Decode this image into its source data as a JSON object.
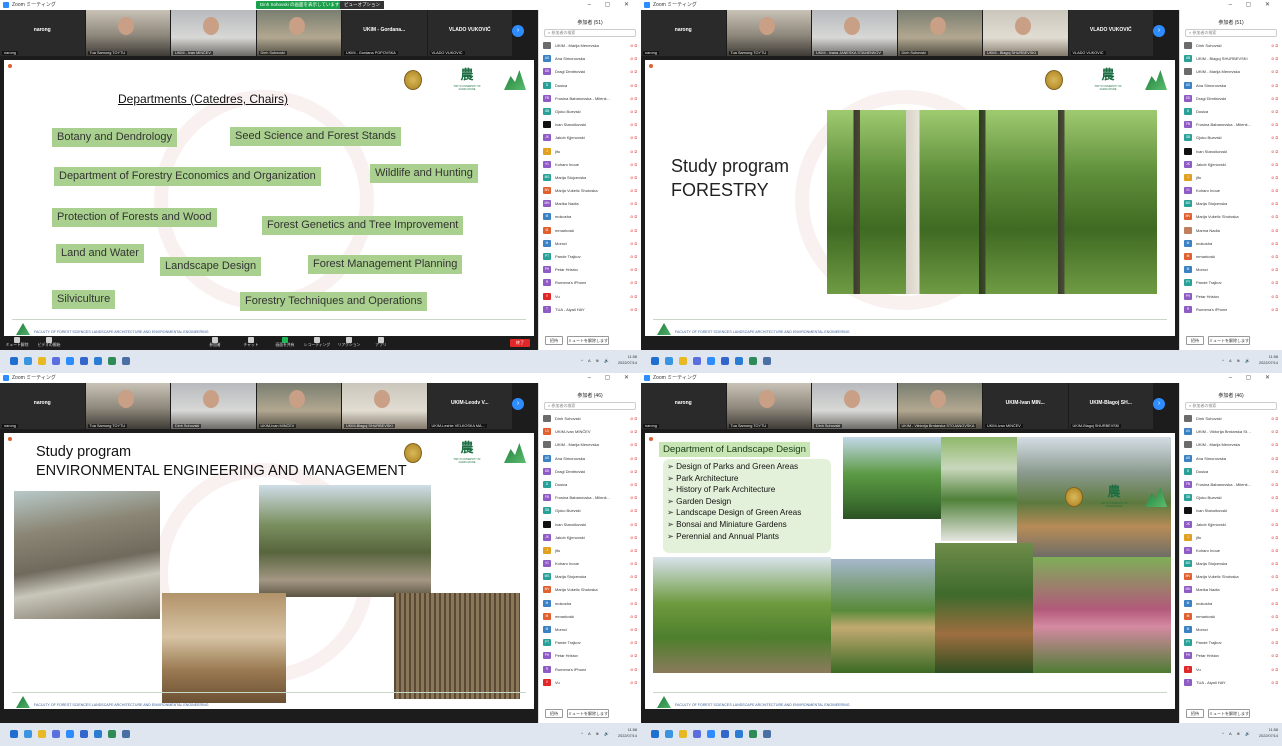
{
  "common": {
    "window_title": "Zoom ミーティング",
    "participants_search_placeholder": "参加者の検索",
    "invite_label": "招待",
    "unmute_all_label": "ミュートを解除します",
    "end_label": "終了",
    "clock_time": "11:58",
    "clock_date": "2022/07/14",
    "accent_color": "#2d8cff",
    "slide_green": "#a9d08e",
    "mic_off_glyph": "⊘ ⧄",
    "footer_text": "FACULTY OF FOREST SCIENCES LANDSCAPE ARCHITECTURE AND ENVIRONMENTAL ENGINEERING",
    "tokyo_logo_char": "農",
    "tokyo_logo_text": "TOKYO UNIVERSITY OF AGRICULTURE",
    "next_icon": "chevron-right-icon"
  },
  "toolbar": {
    "items": [
      "ミュート解除",
      "ビデオの開始",
      "参加者",
      "チャット",
      "画面を共有",
      "レコーディング",
      "リアクション",
      "アプリ"
    ],
    "participants_count": "51"
  },
  "q0": {
    "banner": "Dinh Sohovski の画面を表示しています",
    "view_option": "ビューオプション",
    "participants_title": "参加者 (51)",
    "gallery": [
      {
        "type": "name",
        "name": "narong",
        "label": "narong"
      },
      {
        "type": "video",
        "label": "Tua Sarnong TOYTU"
      },
      {
        "type": "video",
        "label": "UKIM - Ivan MINČEV"
      },
      {
        "type": "video",
        "label": "Dinh Sohovski"
      },
      {
        "type": "name",
        "name": "UKIM - Gordana...",
        "label": "UKIM - Gordana POPOVSKA"
      },
      {
        "type": "name",
        "name": "VLADO VUKOVIĆ",
        "label": "VLADO VUKOVIĆ"
      }
    ],
    "slide": {
      "title": "Departments (Catedres, Chairs)",
      "boxes": [
        "Botany and Dendrology",
        "Seed Science and Forest Stands",
        "Department of Forestry Economics and Organization",
        "Wildlife and Hunting",
        "Protection of Forests and Wood",
        "Forest Genetics and Tree Improvement",
        "Land and Water",
        "Landscape Design",
        "Forest Management Planning",
        "Silviculture",
        "Forestry Techniques and Operations"
      ]
    },
    "participants": [
      {
        "name": "UKIM - Marija Menevska",
        "initials": "",
        "color": "#6b6b6b"
      },
      {
        "name": "Ana Simonovska",
        "initials": "AS",
        "color": "#3b82c4"
      },
      {
        "name": "Dragi Dimitrovski",
        "initials": "DD",
        "color": "#8e5cc4"
      },
      {
        "name": "Dusica",
        "initials": "D",
        "color": "#2aa198"
      },
      {
        "name": "Frosina Babanovska - Milenkov...",
        "initials": "FB",
        "color": "#8e5cc4"
      },
      {
        "name": "Gjoko Buevski",
        "initials": "GB",
        "color": "#2aa198"
      },
      {
        "name": "Ivan Stanoikovski",
        "initials": "",
        "color": "#111111"
      },
      {
        "name": "Jakob Kjjenovski",
        "initials": "JK",
        "color": "#8e5cc4"
      },
      {
        "name": "jifu",
        "initials": "J",
        "color": "#e0a020"
      },
      {
        "name": "Koharo Inoue",
        "initials": "KI",
        "color": "#8e5cc4"
      },
      {
        "name": "Marija Stojcevska",
        "initials": "MS",
        "color": "#2aa198"
      },
      {
        "name": "Marija Vukelic Shutoska",
        "initials": "MV",
        "color": "#e06030"
      },
      {
        "name": "Marika Nadia",
        "initials": "MN",
        "color": "#8e5cc4"
      },
      {
        "name": "mokosha",
        "initials": "M",
        "color": "#3b82c4"
      },
      {
        "name": "mmarkoski",
        "initials": "M",
        "color": "#e06030"
      },
      {
        "name": "Momci",
        "initials": "M",
        "color": "#3b82c4"
      },
      {
        "name": "Pande Trajkov",
        "initials": "PT",
        "color": "#2aa198"
      },
      {
        "name": "Petar Hristov",
        "initials": "PH",
        "color": "#8e5cc4"
      },
      {
        "name": "Rumena's iPhone",
        "initials": "R",
        "color": "#8e5cc4"
      },
      {
        "name": "Vu",
        "initials": "V",
        "color": "#e02828"
      },
      {
        "name": "TUA - Aiyali HAY",
        "initials": "T",
        "color": "#8e5cc4"
      }
    ]
  },
  "q1": {
    "participants_title": "参加者 (51)",
    "gallery": [
      {
        "type": "name",
        "name": "narong",
        "label": "narong"
      },
      {
        "type": "video",
        "label": "Tua Sarnong TOYTU"
      },
      {
        "type": "video",
        "label": "UKIM - Ivana JANESKA STAMENKOV"
      },
      {
        "type": "video",
        "label": "Dinh Sohovski"
      },
      {
        "type": "video",
        "label": "UKIM - Blagoj SHURBEVSKI"
      },
      {
        "type": "name",
        "name": "VLADO VUKOVIĆ",
        "label": "VLADO VUKOVIĆ"
      }
    ],
    "slide": {
      "line1": "Study program",
      "line2": "FORESTRY"
    },
    "participants": [
      {
        "name": "Dinh Sohovski",
        "initials": "",
        "color": "#6b6b6b"
      },
      {
        "name": "UKIM - Blagoj SHURBEVSKI",
        "initials": "UB",
        "color": "#2aa198"
      },
      {
        "name": "UKIM - Marija Menevska",
        "initials": "",
        "color": "#6b6b6b"
      },
      {
        "name": "Ana Simonovska",
        "initials": "AS",
        "color": "#3b82c4"
      },
      {
        "name": "Dragi Dimitrovski",
        "initials": "DD",
        "color": "#8e5cc4"
      },
      {
        "name": "Dusica",
        "initials": "D",
        "color": "#2aa198"
      },
      {
        "name": "Frosina Babanovska - Milenkov...",
        "initials": "FB",
        "color": "#8e5cc4"
      },
      {
        "name": "Gjoko Buevski",
        "initials": "GB",
        "color": "#2aa198"
      },
      {
        "name": "Ivan Stanoikovski",
        "initials": "",
        "color": "#111111"
      },
      {
        "name": "Jakob Kjjenovski",
        "initials": "JK",
        "color": "#8e5cc4"
      },
      {
        "name": "jifu",
        "initials": "J",
        "color": "#e0a020"
      },
      {
        "name": "Koharo Inoue",
        "initials": "KI",
        "color": "#8e5cc4"
      },
      {
        "name": "Marija Stojcevska",
        "initials": "MS",
        "color": "#2aa198"
      },
      {
        "name": "Marija Vukelic Shutoska",
        "initials": "MV",
        "color": "#e06030"
      },
      {
        "name": "Marina Nadia",
        "initials": "",
        "color": "#c08060"
      },
      {
        "name": "mokosha",
        "initials": "M",
        "color": "#3b82c4"
      },
      {
        "name": "mmarkoski",
        "initials": "M",
        "color": "#e06030"
      },
      {
        "name": "Momci",
        "initials": "M",
        "color": "#3b82c4"
      },
      {
        "name": "Pande Trajkov",
        "initials": "PT",
        "color": "#2aa198"
      },
      {
        "name": "Petar Hristov",
        "initials": "PH",
        "color": "#8e5cc4"
      },
      {
        "name": "Rumena's iPhone",
        "initials": "R",
        "color": "#8e5cc4"
      }
    ]
  },
  "q2": {
    "participants_title": "参加者 (46)",
    "gallery": [
      {
        "type": "name",
        "name": "narong",
        "label": "narong"
      },
      {
        "type": "video",
        "label": "Tua Sarnong TOYTU"
      },
      {
        "type": "video",
        "label": "Dinh Sohovski"
      },
      {
        "type": "video",
        "label": "UKIM-Ivan MINČEV"
      },
      {
        "type": "video",
        "label": "UKIM-Blagoj SHURBEVSKI"
      },
      {
        "type": "name",
        "name": "UKIM-Leodv V...",
        "label": "UKIM-Leshte VELKOSKA MA..."
      }
    ],
    "slide": {
      "line1": "Study program",
      "line2": "ENVIRONMENTAL ENGINEERING AND MANAGEMENT"
    },
    "participants": [
      {
        "name": "Dinh Sohovski",
        "initials": "",
        "color": "#6b6b6b"
      },
      {
        "name": "UKIM-Ivan MINČEV",
        "initials": "UI",
        "color": "#e06030"
      },
      {
        "name": "UKIM - Marija Menevska",
        "initials": "",
        "color": "#6b6b6b"
      },
      {
        "name": "Ana Simonovska",
        "initials": "AS",
        "color": "#3b82c4"
      },
      {
        "name": "Dragi Dimitrovski",
        "initials": "DD",
        "color": "#8e5cc4"
      },
      {
        "name": "Dusica",
        "initials": "D",
        "color": "#2aa198"
      },
      {
        "name": "Frosina Babanovska - Milenkov...",
        "initials": "FB",
        "color": "#8e5cc4"
      },
      {
        "name": "Gjoko Buevski",
        "initials": "GB",
        "color": "#2aa198"
      },
      {
        "name": "Ivan Stanoikovski",
        "initials": "",
        "color": "#111111"
      },
      {
        "name": "Jakob Kjjenovski",
        "initials": "JK",
        "color": "#8e5cc4"
      },
      {
        "name": "jifu",
        "initials": "J",
        "color": "#e0a020"
      },
      {
        "name": "Koharo Inoue",
        "initials": "KI",
        "color": "#8e5cc4"
      },
      {
        "name": "Marija Stojcevska",
        "initials": "MS",
        "color": "#2aa198"
      },
      {
        "name": "Marija Vukelic Shutoska",
        "initials": "MV",
        "color": "#e06030"
      },
      {
        "name": "mokosha",
        "initials": "M",
        "color": "#3b82c4"
      },
      {
        "name": "mmarkoski",
        "initials": "M",
        "color": "#e06030"
      },
      {
        "name": "Momci",
        "initials": "M",
        "color": "#3b82c4"
      },
      {
        "name": "Pande Trajkov",
        "initials": "PT",
        "color": "#2aa198"
      },
      {
        "name": "Petar Hristov",
        "initials": "PH",
        "color": "#8e5cc4"
      },
      {
        "name": "Rumena's iPhone",
        "initials": "R",
        "color": "#8e5cc4"
      },
      {
        "name": "Vu",
        "initials": "V",
        "color": "#e02828"
      }
    ]
  },
  "q3": {
    "participants_title": "参加者 (46)",
    "gallery": [
      {
        "type": "name",
        "name": "narong",
        "label": "narong"
      },
      {
        "type": "video",
        "label": "Tua Sarnong TOYTU"
      },
      {
        "type": "video",
        "label": "Dinh Sohovski"
      },
      {
        "type": "video",
        "label": "UKIM - Viktorija Brrdarska STOJANOVSKA"
      },
      {
        "type": "name",
        "name": "UKIM-Ivan MIN...",
        "label": "UKIM-Ivan MINČEV"
      },
      {
        "type": "name",
        "name": "UKIM-Blagoj SH...",
        "label": "UKIM-Blagoj SHURBEVSKI"
      }
    ],
    "slide": {
      "title": "Department of Landscape Design",
      "items": [
        "Design of Parks and Green Areas",
        "Park Architecture",
        "History of Park Architecture",
        "Garden Design",
        "Landscape Design of Green Areas",
        "Bonsai and Miniature Gardens",
        "Perennial and Annual Plants"
      ]
    },
    "participants": [
      {
        "name": "Dinh Sohovski",
        "initials": "",
        "color": "#6b6b6b"
      },
      {
        "name": "UKIM - Viktorija Brrdarska Stoj...",
        "initials": "UV",
        "color": "#3b82c4"
      },
      {
        "name": "UKIM - Marija Menevska",
        "initials": "",
        "color": "#6b6b6b"
      },
      {
        "name": "Ana Simonovska",
        "initials": "AS",
        "color": "#3b82c4"
      },
      {
        "name": "Dusica",
        "initials": "D",
        "color": "#2aa198"
      },
      {
        "name": "Frosina Babanovska - Milenkov...",
        "initials": "FB",
        "color": "#8e5cc4"
      },
      {
        "name": "Gjoko Buevski",
        "initials": "GB",
        "color": "#2aa198"
      },
      {
        "name": "Ivan Stanoikovski",
        "initials": "",
        "color": "#111111"
      },
      {
        "name": "Jakob Kjjenovski",
        "initials": "JK",
        "color": "#8e5cc4"
      },
      {
        "name": "jifu",
        "initials": "J",
        "color": "#e0a020"
      },
      {
        "name": "Koharo Inoue",
        "initials": "KI",
        "color": "#8e5cc4"
      },
      {
        "name": "Marija Stojcevska",
        "initials": "MS",
        "color": "#2aa198"
      },
      {
        "name": "Marija Vukelic Shutoska",
        "initials": "MV",
        "color": "#e06030"
      },
      {
        "name": "Marika Nadia",
        "initials": "MN",
        "color": "#8e5cc4"
      },
      {
        "name": "mokosha",
        "initials": "M",
        "color": "#3b82c4"
      },
      {
        "name": "mmarkoski",
        "initials": "M",
        "color": "#e06030"
      },
      {
        "name": "Momci",
        "initials": "M",
        "color": "#3b82c4"
      },
      {
        "name": "Pande Trajkov",
        "initials": "PT",
        "color": "#2aa198"
      },
      {
        "name": "Petar Hristov",
        "initials": "PH",
        "color": "#8e5cc4"
      },
      {
        "name": "Vu",
        "initials": "V",
        "color": "#e02828"
      },
      {
        "name": "TUA - Aiyali HAY",
        "initials": "T",
        "color": "#8e5cc4"
      }
    ]
  }
}
